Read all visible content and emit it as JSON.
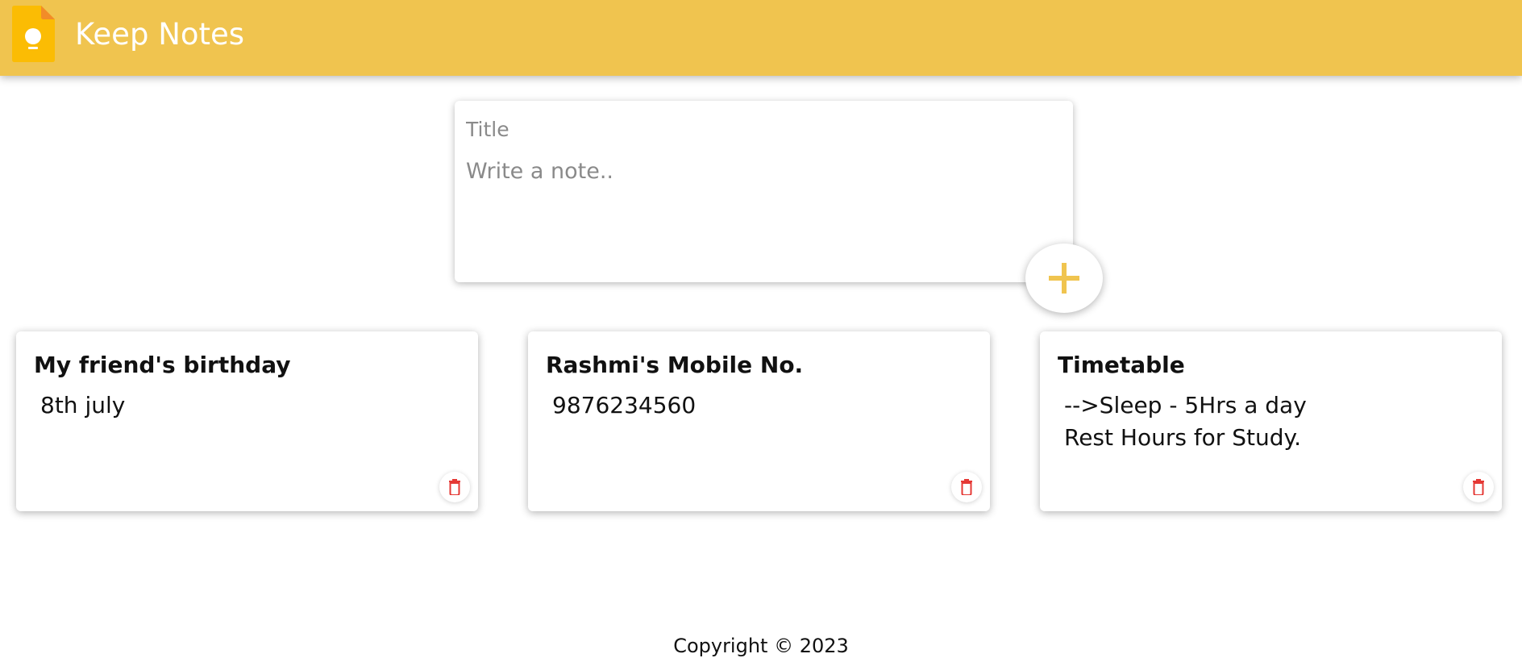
{
  "header": {
    "app_title": "Keep Notes",
    "logo_icon": "keep-lightbulb-icon",
    "background_color": "#f0c44f"
  },
  "composer": {
    "title_placeholder": "Title",
    "note_placeholder": "Write a note..",
    "add_icon": "plus-icon",
    "accent_color": "#f0c44f"
  },
  "notes": [
    {
      "title": "My friend's birthday",
      "body": "8th july",
      "delete_icon": "trash-icon"
    },
    {
      "title": "Rashmi's Mobile No.",
      "body": "9876234560",
      "delete_icon": "trash-icon"
    },
    {
      "title": "Timetable",
      "body": "-->Sleep - 5Hrs a day\nRest Hours for Study.",
      "delete_icon": "trash-icon"
    }
  ],
  "footer": {
    "copyright": "Copyright © 2023"
  },
  "colors": {
    "delete": "#e53935",
    "logo_orange": "#f4a316",
    "logo_yellow": "#fbbc04"
  }
}
